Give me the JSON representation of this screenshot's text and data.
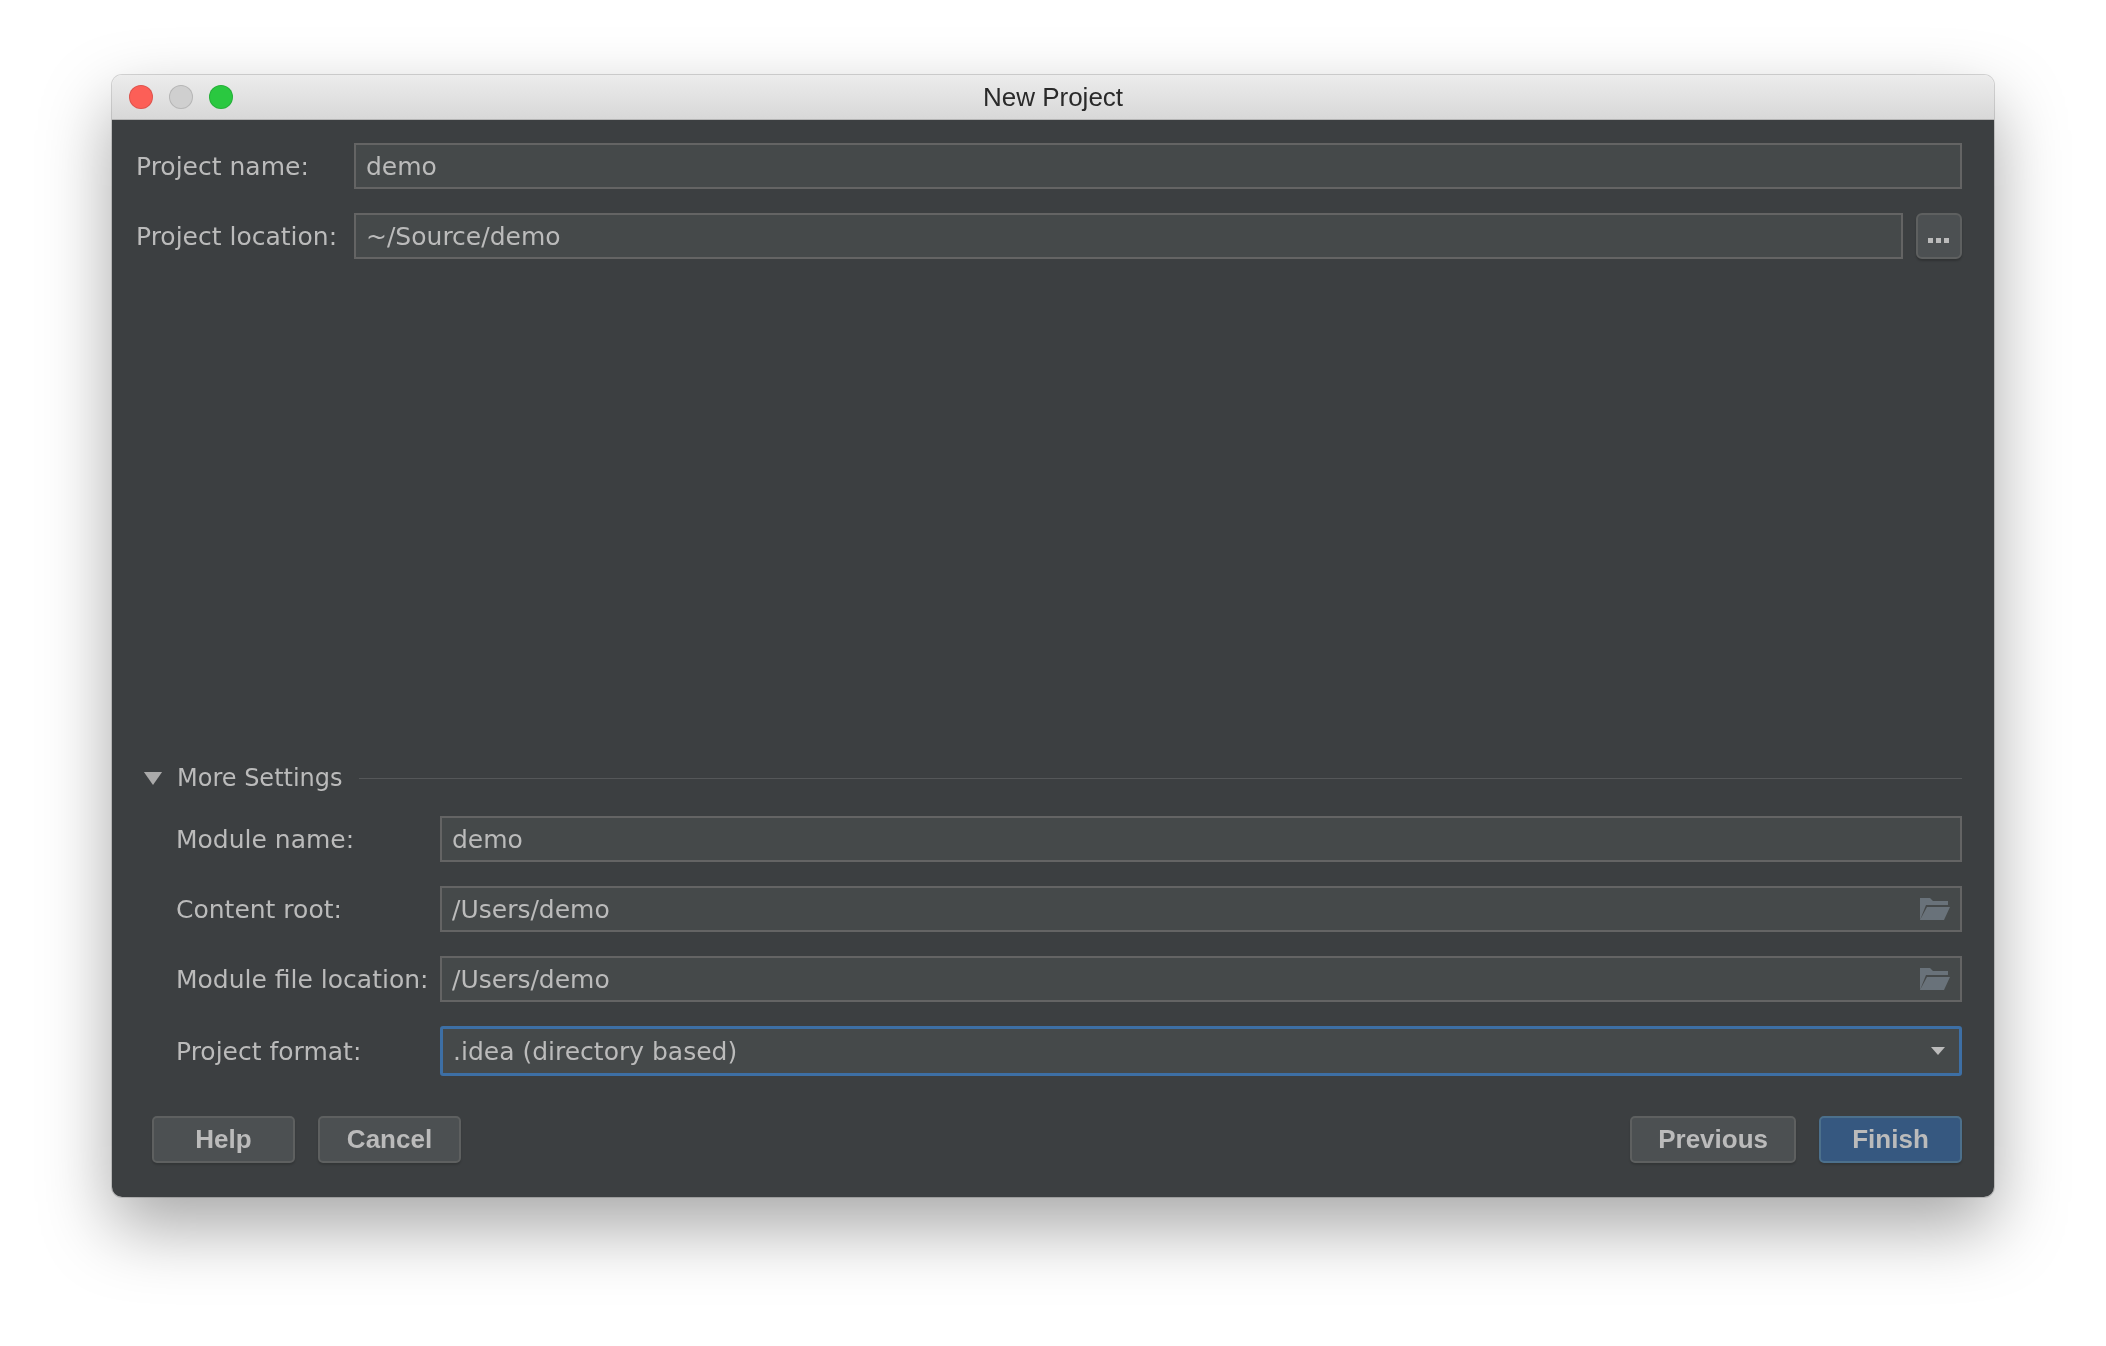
{
  "window": {
    "title": "New Project",
    "controls": [
      {
        "kind": "close",
        "disabled": false
      },
      {
        "kind": "minimize",
        "disabled": true
      },
      {
        "kind": "zoom",
        "disabled": false
      }
    ]
  },
  "fields": [
    {
      "label": "Project name:",
      "value": "demo",
      "kind": "text",
      "focused": false
    },
    {
      "label": "Project location:",
      "value": "~/Source/demo",
      "kind": "browse",
      "focused": false
    }
  ],
  "more_settings": {
    "label": "More Settings",
    "expanded": true,
    "fields": [
      {
        "label": "Module name:",
        "value": "demo",
        "kind": "text",
        "focused": false
      },
      {
        "label": "Content root:",
        "value": "/Users/demo",
        "kind": "folder",
        "focused": false
      },
      {
        "label": "Module file location:",
        "value": "/Users/demo",
        "kind": "folder",
        "focused": false
      },
      {
        "label": "Project format:",
        "value": ".idea (directory based)",
        "kind": "dropdown",
        "focused": true
      }
    ]
  },
  "buttons_left": [
    {
      "label": "Help",
      "default": false
    },
    {
      "label": "Cancel",
      "default": false
    }
  ],
  "buttons_right": [
    {
      "label": "Previous",
      "default": false
    },
    {
      "label": "Finish",
      "default": true
    }
  ]
}
